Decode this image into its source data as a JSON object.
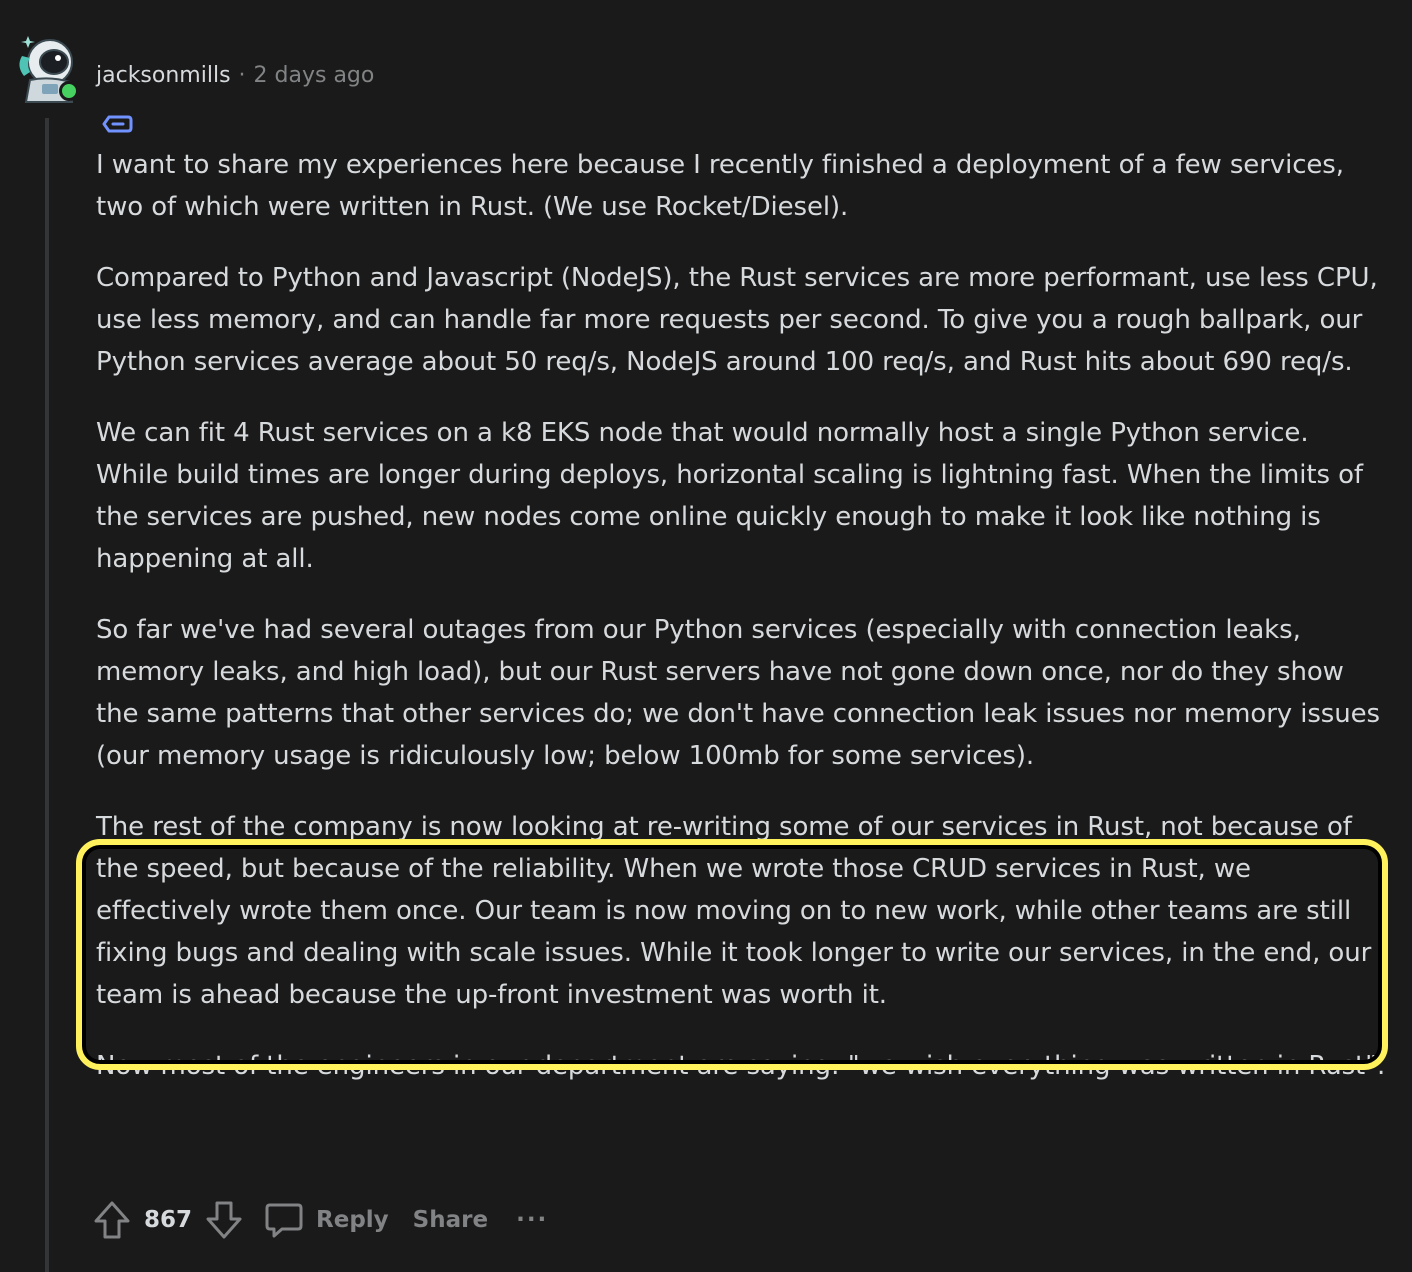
{
  "comment": {
    "username": "jacksonmills",
    "separator": "·",
    "timestamp": "2 days ago",
    "paragraphs": [
      "I want to share my experiences here because I recently finished a deployment of a few services, two of which were written in Rust. (We use Rocket/Diesel).",
      "Compared to Python and Javascript (NodeJS), the Rust services are more performant, use less CPU, use less memory, and can handle far more requests per second. To give you a rough ballpark, our Python services average about 50 req/s, NodeJS around 100 req/s, and Rust hits about 690 req/s.",
      "We can fit 4 Rust services on a k8 EKS node that would normally host a single Python service. While build times are longer during deploys, horizontal scaling is lightning fast. When the limits of the services are pushed, new nodes come online quickly enough to make it look like nothing is happening at all.",
      "So far we've had several outages from our Python services (especially with connection leaks, memory leaks, and high load), but our Rust servers have not gone down once, nor do they show the same patterns that other services do; we don't have connection leak issues nor memory issues (our memory usage is ridiculously low; below 100mb for some services).",
      "The rest of the company is now looking at re-writing some of our services in Rust, not because of the speed, but because of the reliability. When we wrote those CRUD services in Rust, we effectively wrote them once. Our team is now moving on to new work, while other teams are still fixing bugs and dealing with scale issues. While it took longer to write our services, in the end, our team is ahead because the up-front investment was worth it.",
      "Now most of the engineers in our department are saying: \"we wish everything was written in Rust\"."
    ]
  },
  "actions": {
    "score": "867",
    "reply_label": "Reply",
    "share_label": "Share",
    "more_label": "···"
  },
  "icons": {
    "avatar": "avatar-icon",
    "flair": "tag-icon",
    "upvote": "upvote-arrow-icon",
    "downvote": "downvote-arrow-icon",
    "reply": "speech-bubble-icon",
    "more": "ellipsis-icon"
  },
  "colors": {
    "background": "#1a1a1b",
    "text": "#d7dadc",
    "muted": "#818384",
    "highlight": "#fff15b",
    "online": "#46d160"
  }
}
